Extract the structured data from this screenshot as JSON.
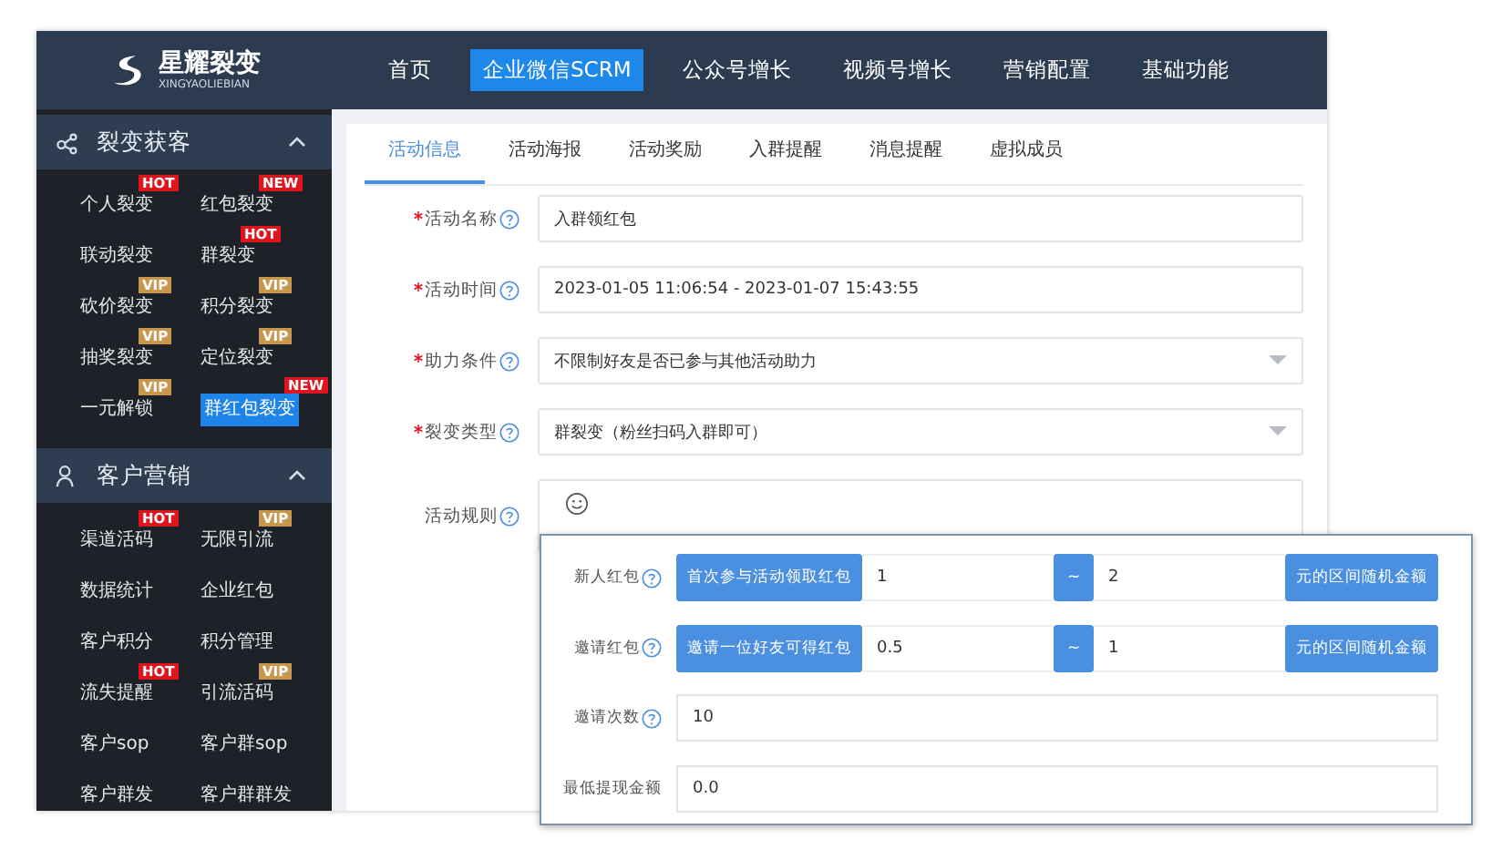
{
  "logo": {
    "name": "星耀裂变",
    "subtitle": "XINGYAOLIEBIAN"
  },
  "nav": [
    {
      "label": "首页",
      "selected": false
    },
    {
      "label": "企业微信SCRM",
      "selected": true
    },
    {
      "label": "公众号增长",
      "selected": false
    },
    {
      "label": "视频号增长",
      "selected": false
    },
    {
      "label": "营销配置",
      "selected": false
    },
    {
      "label": "基础功能",
      "selected": false
    }
  ],
  "sidebar": [
    {
      "title": "裂变获客",
      "expanded": true,
      "rows": [
        [
          {
            "label": "个人裂变",
            "selected": false,
            "badge": {
              "text": "HOT",
              "kind": "hot"
            }
          },
          {
            "label": "红包裂变",
            "selected": false,
            "badge": {
              "text": "NEW",
              "kind": "new"
            }
          }
        ],
        [
          {
            "label": "联动裂变",
            "selected": false
          },
          {
            "label": "群裂变",
            "selected": false,
            "badge": {
              "text": "HOT",
              "kind": "hot"
            }
          }
        ],
        [
          {
            "label": "砍价裂变",
            "selected": false,
            "badge": {
              "text": "VIP",
              "kind": "vip"
            }
          },
          {
            "label": "积分裂变",
            "selected": false,
            "badge": {
              "text": "VIP",
              "kind": "vip"
            }
          }
        ],
        [
          {
            "label": "抽奖裂变",
            "selected": false,
            "badge": {
              "text": "VIP",
              "kind": "vip"
            }
          },
          {
            "label": "定位裂变",
            "selected": false,
            "badge": {
              "text": "VIP",
              "kind": "vip"
            }
          }
        ],
        [
          {
            "label": "一元解锁",
            "selected": false,
            "badge": {
              "text": "VIP",
              "kind": "vip"
            }
          },
          {
            "label": "群红包裂变",
            "selected": true,
            "badge": {
              "text": "NEW",
              "kind": "new"
            }
          }
        ]
      ]
    },
    {
      "title": "客户营销",
      "expanded": true,
      "rows": [
        [
          {
            "label": "渠道活码",
            "selected": false,
            "badge": {
              "text": "HOT",
              "kind": "hot"
            }
          },
          {
            "label": "无限引流",
            "selected": false,
            "badge": {
              "text": "VIP",
              "kind": "vip"
            }
          }
        ],
        [
          {
            "label": "数据统计",
            "selected": false
          },
          {
            "label": "企业红包",
            "selected": false
          }
        ],
        [
          {
            "label": "客户积分",
            "selected": false
          },
          {
            "label": "积分管理",
            "selected": false
          }
        ],
        [
          {
            "label": "流失提醒",
            "selected": false,
            "badge": {
              "text": "HOT",
              "kind": "hot"
            }
          },
          {
            "label": "引流活码",
            "selected": false,
            "badge": {
              "text": "VIP",
              "kind": "vip"
            }
          }
        ],
        [
          {
            "label": "客户sop",
            "selected": false
          },
          {
            "label": "客户群sop",
            "selected": false
          }
        ],
        [
          {
            "label": "客户群发",
            "selected": false
          },
          {
            "label": "客户群群发",
            "selected": false
          }
        ]
      ]
    }
  ],
  "tabs": [
    {
      "label": "活动信息",
      "selected": true
    },
    {
      "label": "活动海报",
      "selected": false
    },
    {
      "label": "活动奖励",
      "selected": false
    },
    {
      "label": "入群提醒",
      "selected": false
    },
    {
      "label": "消息提醒",
      "selected": false
    },
    {
      "label": "虚拟成员",
      "selected": false
    }
  ],
  "form": [
    {
      "label": "活动名称",
      "required": true,
      "help": true,
      "kind": "text",
      "value": "入群领红包"
    },
    {
      "label": "活动时间",
      "required": true,
      "help": true,
      "kind": "text",
      "value": "2023-01-05 11:06:54 - 2023-01-07 15:43:55"
    },
    {
      "label": "助力条件",
      "required": true,
      "help": true,
      "kind": "select",
      "value": "不限制好友是否已参与其他活动助力"
    },
    {
      "label": "裂变类型",
      "required": true,
      "help": true,
      "kind": "select",
      "value": "群裂变（粉丝扫码入群即可）"
    },
    {
      "label": "活动规则",
      "required": false,
      "help": true,
      "kind": "editor"
    }
  ],
  "popup": [
    {
      "label": "新人红包",
      "help": true,
      "kind": "range",
      "prefix": "首次参与活动领取红包",
      "min": "1",
      "separator": "~",
      "max": "2",
      "suffix": "元的区间随机金额"
    },
    {
      "label": "邀请红包",
      "help": true,
      "kind": "range",
      "prefix": "邀请一位好友可得红包",
      "min": "0.5",
      "separator": "~",
      "max": "1",
      "suffix": "元的区间随机金额"
    },
    {
      "label": "邀请次数",
      "help": true,
      "kind": "text",
      "value": "10"
    },
    {
      "label": "最低提现金额",
      "kind": "text",
      "value": "0.0"
    }
  ]
}
